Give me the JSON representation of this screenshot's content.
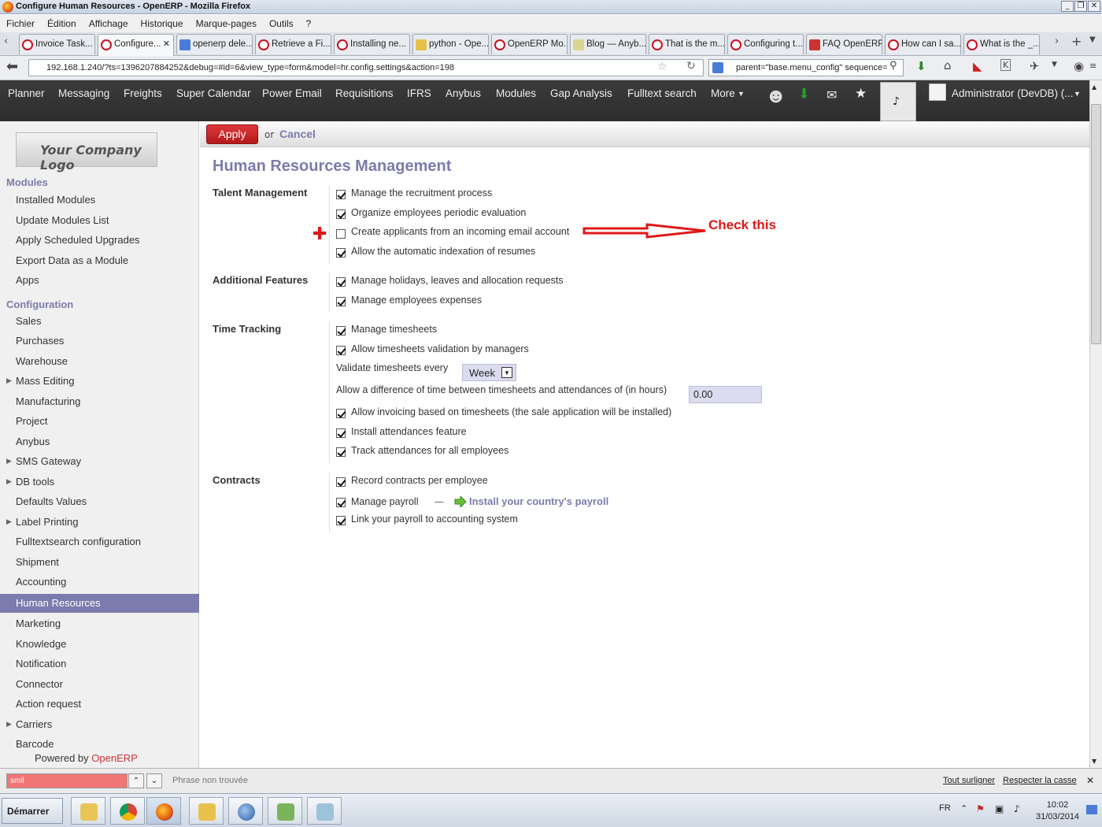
{
  "window": {
    "title": "Configure Human Resources - OpenERP - Mozilla Firefox"
  },
  "menubar": [
    "Fichier",
    "Édition",
    "Affichage",
    "Historique",
    "Marque-pages",
    "Outils",
    "?"
  ],
  "tabs": [
    {
      "label": "Invoice Task..."
    },
    {
      "label": "Configure..."
    },
    {
      "label": "openerp dele..."
    },
    {
      "label": "Retrieve a Fi..."
    },
    {
      "label": "Installing ne..."
    },
    {
      "label": "python - Ope..."
    },
    {
      "label": "OpenERP Mo..."
    },
    {
      "label": "Blog — Anyb..."
    },
    {
      "label": "That is the m..."
    },
    {
      "label": "Configuring t..."
    },
    {
      "label": "FAQ OpenERP"
    },
    {
      "label": "How can I sa..."
    },
    {
      "label": "What is the _..."
    }
  ],
  "nav": {
    "url": "192.168.1.240/?ts=1396207884252&debug=#id=6&view_type=form&model=hr.config.settings&action=198",
    "search": "parent=\"base.menu_config\" sequence="
  },
  "topmenu": [
    "Planner",
    "Messaging",
    "Freights",
    "Super Calendar",
    "Power Email",
    "Requisitions",
    "IFRS",
    "Anybus",
    "Modules",
    "Gap Analysis",
    "Fulltext search",
    "More"
  ],
  "user": "Administrator (DevDB) (...",
  "sidebar": {
    "logo_text": "Your Company Logo",
    "modules_header": "Modules",
    "modules": [
      "Installed Modules",
      "Update Modules List",
      "Apply Scheduled Upgrades",
      "Export Data as a Module",
      "Apps"
    ],
    "config_header": "Configuration",
    "config": [
      "Sales",
      "Purchases",
      "Warehouse",
      "Mass Editing",
      "Manufacturing",
      "Project",
      "Anybus",
      "SMS Gateway",
      "DB tools",
      "Defaults Values",
      "Label Printing",
      "Fulltextsearch configuration",
      "Shipment",
      "Accounting",
      "Human Resources",
      "Marketing",
      "Knowledge",
      "Notification",
      "Connector",
      "Action request",
      "Carriers",
      "Barcode"
    ],
    "powered_prefix": "Powered by",
    "powered_brand": "OpenERP"
  },
  "actions": {
    "apply": "Apply",
    "or": "or",
    "cancel": "Cancel"
  },
  "page_title": "Human Resources Management",
  "sections": {
    "talent": {
      "label": "Talent Management",
      "items": [
        {
          "label": "Manage the recruitment process",
          "checked": true
        },
        {
          "label": "Organize employees periodic evaluation",
          "checked": true
        },
        {
          "label": "Create applicants from an incoming email account",
          "checked": false
        },
        {
          "label": "Allow the automatic indexation of resumes",
          "checked": true
        }
      ]
    },
    "additional": {
      "label": "Additional Features",
      "items": [
        {
          "label": "Manage holidays, leaves and allocation requests",
          "checked": true
        },
        {
          "label": "Manage employees expenses",
          "checked": true
        }
      ]
    },
    "time": {
      "label": "Time Tracking",
      "items": [
        {
          "label": "Manage timesheets",
          "checked": true
        },
        {
          "label": "Allow timesheets validation by managers",
          "checked": true
        },
        {
          "label": "Allow invoicing based on timesheets (the sale application will be installed)",
          "checked": true
        },
        {
          "label": "Install attendances feature",
          "checked": true
        },
        {
          "label": "Track attendances for all employees",
          "checked": true
        }
      ],
      "validate_label": "Validate timesheets every",
      "validate_value": "Week",
      "difference_label": "Allow a difference of time between timesheets and attendances of (in hours)",
      "difference_value": "0.00"
    },
    "contracts": {
      "label": "Contracts",
      "items": [
        {
          "label": "Record contracts per employee",
          "checked": true
        },
        {
          "label": "Manage payroll",
          "checked": true
        },
        {
          "label": "Link your payroll to accounting system",
          "checked": true
        }
      ],
      "payroll_dash": "—",
      "payroll_link": "Install your country's payroll"
    }
  },
  "annotation": {
    "text": "Check this",
    "color": "#e01818"
  },
  "findbar": {
    "value": "smil",
    "status": "Phrase non trouvée",
    "highlight": "Tout surligner",
    "match_case": "Respecter la casse"
  },
  "taskbar": {
    "start": "Démarrer",
    "lang": "FR",
    "time": "10:02",
    "date": "31/03/2014"
  },
  "colors": {
    "accent": "#7c7bad",
    "apply": "#c92223",
    "menubar": "#333333"
  }
}
